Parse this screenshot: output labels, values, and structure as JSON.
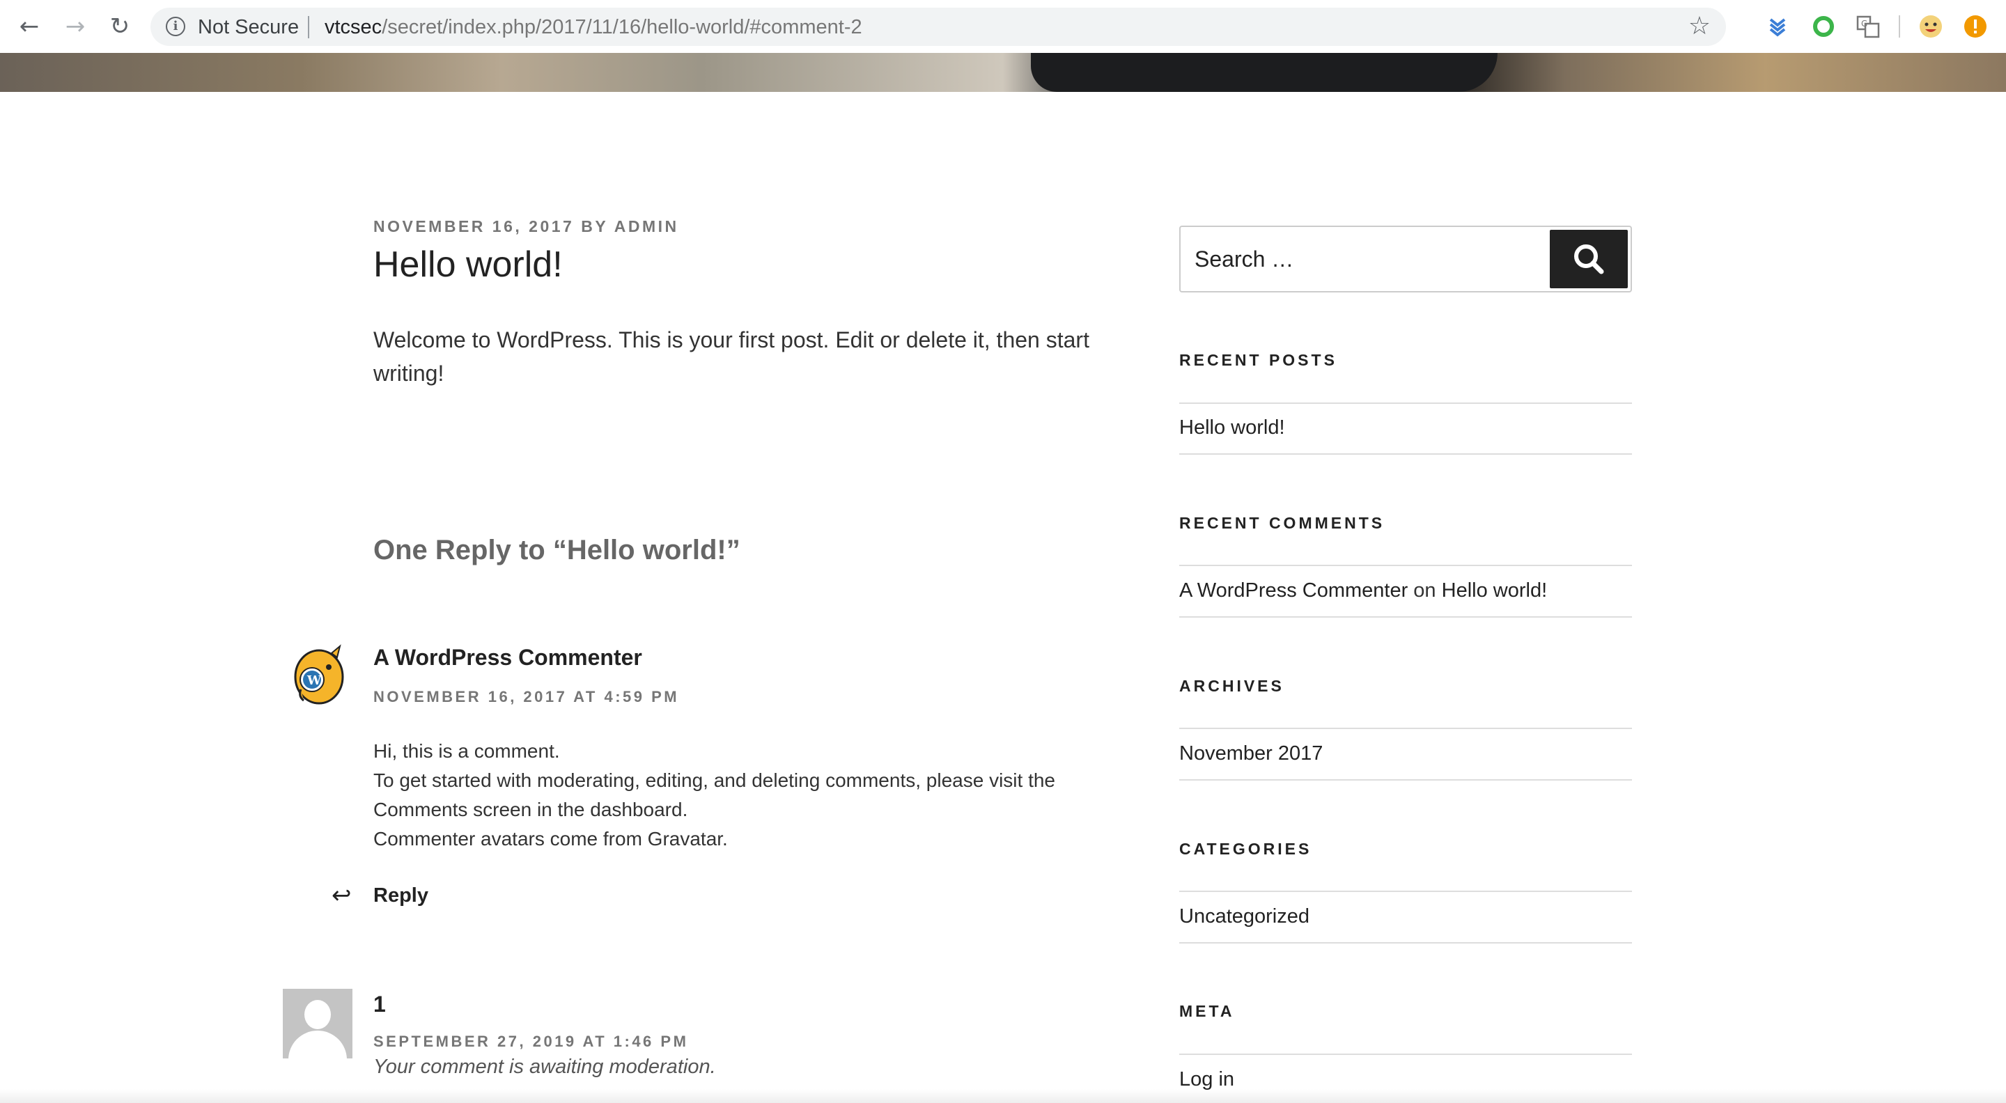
{
  "browser": {
    "security_label": "Not Secure",
    "url_host": "vtcsec",
    "url_path": "/secret/index.php/2017/11/16/hello-world/#comment-2",
    "extension_colors": {
      "pocket": "#3b7ed6",
      "circle": "#3cb54a",
      "avatar": "#e9a71f",
      "alert": "#f29900"
    }
  },
  "post": {
    "meta": "NOVEMBER 16, 2017 BY ADMIN",
    "title": "Hello world!",
    "body": "Welcome to WordPress. This is your first post. Edit or delete it, then start writing!"
  },
  "comments": {
    "heading": "One Reply to “Hello world!”",
    "items": [
      {
        "author": "A WordPress Commenter",
        "date": "NOVEMBER 16, 2017 AT 4:59 PM",
        "lines": [
          "Hi, this is a comment.",
          "To get started with moderating, editing, and deleting comments, please visit the",
          "Comments screen in the dashboard.",
          "Commenter avatars come from Gravatar."
        ],
        "reply_label": "Reply"
      },
      {
        "author": "1",
        "date": "SEPTEMBER 27, 2019 AT 1:46 PM",
        "moderation": "Your comment is awaiting moderation."
      }
    ]
  },
  "sidebar": {
    "search_placeholder": "Search …",
    "recent_posts": {
      "title": "RECENT POSTS",
      "items": [
        "Hello world!"
      ]
    },
    "recent_comments": {
      "title": "RECENT COMMENTS",
      "author": "A WordPress Commenter",
      "on": "on",
      "post": "Hello world!"
    },
    "archives": {
      "title": "ARCHIVES",
      "items": [
        "November 2017"
      ]
    },
    "categories": {
      "title": "CATEGORIES",
      "items": [
        "Uncategorized"
      ]
    },
    "meta": {
      "title": "META",
      "items": [
        "Log in"
      ]
    }
  }
}
